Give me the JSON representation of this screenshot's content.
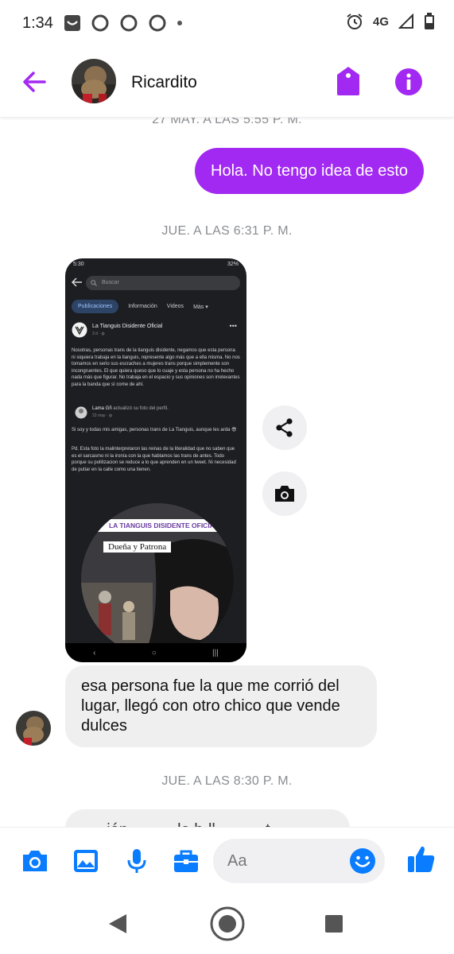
{
  "status_bar": {
    "time": "1:34",
    "network": "4G"
  },
  "header": {
    "contact_name": "Ricardito"
  },
  "accent_color": "#a229f2",
  "icon_color": "#0a7cff",
  "chat": {
    "timestamps": [
      "27 MAY. A LAS 5:55 P. M.",
      "JUE. A LAS 6:31 P. M.",
      "JUE. A LAS 8:30 P. M."
    ],
    "outgoing_message": "Hola. No tengo idea de esto",
    "incoming_message": "esa persona fue la que me corrió del lugar, llegó con otro chico que vende dulces",
    "partial_message": "···· ión ·· ·· ·· lo h·ll ·· ····· t"
  },
  "shared_image": {
    "status_time": "5:30",
    "battery": "32%",
    "search_placeholder": "Buscar",
    "tabs": [
      "Publicaciones",
      "Información",
      "Videos",
      "Más"
    ],
    "page_name": "La Tianguis Disidente Oficial",
    "post_meta": "3 d · ",
    "post_text": "Nosotras, personas trans de la tianguis disidente, negamos que esta persona ni siquiera trabaja en la tianguis, represente algo más que a ella misma. No nos tomamos en serio sus escraches a mujeres trans porque simplemente son incongruentes. El que quiera queso que lo cuaje y esta persona no ha hecho nada más que figurar. No trabaja en el espacio y sus opiniones son irrelevantes para la banda que sí come de ahí.",
    "shared_author": "Lama Gñ",
    "shared_action": "actualizó su foto del perfil.",
    "shared_meta": "23 may · ",
    "shared_text_1": "Si soy y todas mis amigas, personas trans de La Tianguis, aunque les arda 😎",
    "shared_text_2": "Pd. Esta foto la malinterpretaron las reinas de la literalidad que no saben que es el sarcasmo ni la ironía con la que hablamos las trans de antes. Todo porque su politizacion se reduce a lo que aprenden en un tweet. Ni necesidad de putiar en la calle como una tienen.",
    "banner_text": "LA TIANGUIS DISIDENTE OFICIAL",
    "label_text": "Dueña y Patrona"
  },
  "composer": {
    "placeholder": "Aa"
  }
}
